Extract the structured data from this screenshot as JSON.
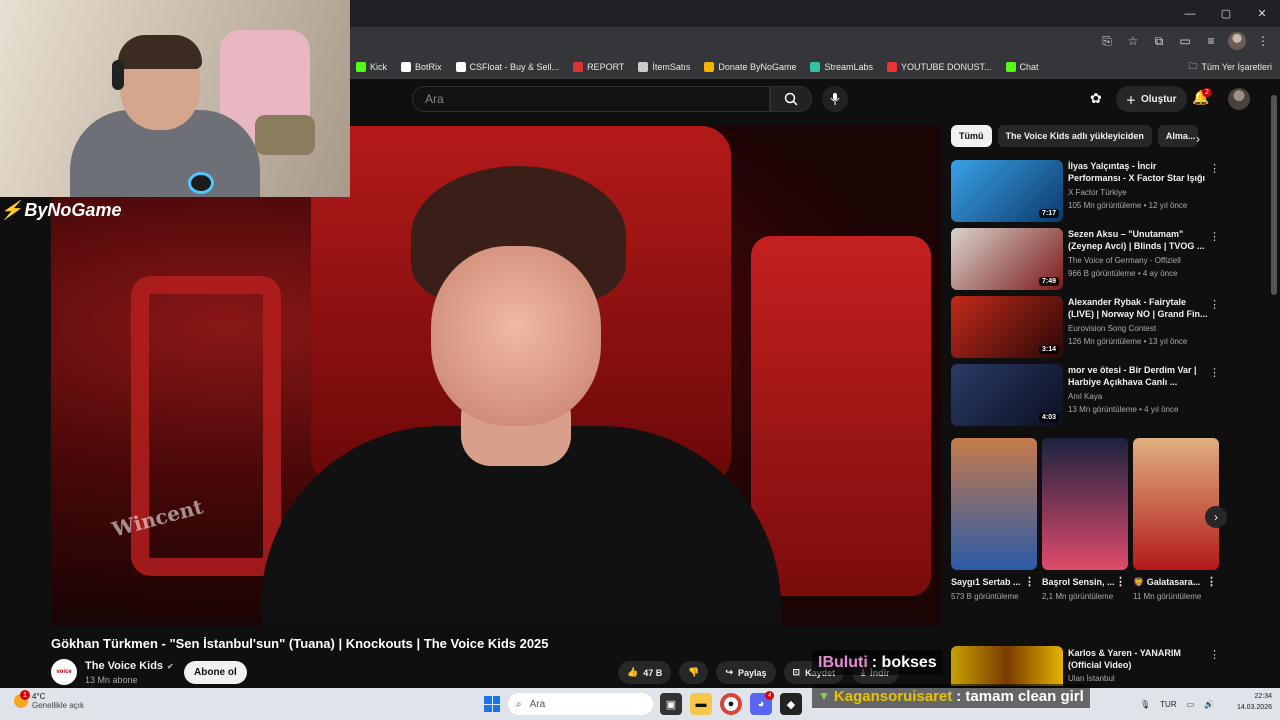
{
  "browser": {
    "controls": [
      "—",
      "▢",
      "✕"
    ],
    "bookmarks": [
      {
        "label": "Kick",
        "color": "#53fc18"
      },
      {
        "label": "BotRix",
        "color": "#ffffff"
      },
      {
        "label": "CSFloat - Buy & Sell...",
        "color": "#ffffff"
      },
      {
        "label": "REPORT",
        "color": "#d33"
      },
      {
        "label": "İtemSatıs",
        "color": "#ccc"
      },
      {
        "label": "Donate ByNoGame",
        "color": "#f7b500"
      },
      {
        "label": "StreamLabs",
        "color": "#31c3a2"
      },
      {
        "label": "YOUTUBE DONUST...",
        "color": "#e33"
      },
      {
        "label": "Chat",
        "color": "#53fc18"
      }
    ],
    "all_bookmarks": "Tüm Yer İşaretleri"
  },
  "youtube": {
    "search_placeholder": "Ara",
    "create_label": "Oluştur",
    "notification_count": "2"
  },
  "video": {
    "title": "Gökhan Türkmen - \"Sen İstanbul'sun\" (Tuana) | Knockouts | The Voice Kids 2025",
    "watermark": "Wincent",
    "channel": "The Voice Kids",
    "subscribers": "13 Mn abone",
    "subscribe_label": "Abone ol",
    "likes": "47 B",
    "share_label": "Paylaş",
    "save_label": "Kaydet",
    "download_label": "İndir"
  },
  "chips": [
    "Tümü",
    "The Voice Kids adlı yükleyiciden",
    "Alma..."
  ],
  "recommendations": [
    {
      "title": "İlyas Yalçıntaş - İncir Performansı - X Factor Star Işığı",
      "channel": "X Factor Türkiye",
      "meta": "105 Mn görüntüleme • 12 yıl önce",
      "duration": "7:17",
      "color1": "#3aa1e6",
      "color2": "#0b3a6b"
    },
    {
      "title": "Sezen Aksu – \"Unutamam\" (Zeynep Avci) | Blinds | TVOG ...",
      "channel": "The Voice of Germany - Offiziell",
      "meta": "966 B görüntüleme • 4 ay önce",
      "duration": "7:49",
      "color1": "#d9d4cc",
      "color2": "#7b1a1a"
    },
    {
      "title": "Alexander Rybak - Fairytale (LIVE) | Norway NO | Grand Fin...",
      "channel": "Eurovision Song Contest",
      "meta": "126 Mn görüntüleme • 13 yıl önce",
      "duration": "3:14",
      "color1": "#c22a1a",
      "color2": "#2a0808"
    },
    {
      "title": "mor ve ötesi - Bir Derdim Var | Harbiye Açıkhava Canlı ...",
      "channel": "Anıl Kaya",
      "meta": "13 Mn görüntüleme • 4 yıl önce",
      "duration": "4:03",
      "color1": "#2b3b66",
      "color2": "#0a0f22"
    }
  ],
  "shorts": [
    {
      "title": "Saygı1 Sertab ...",
      "views": "573 B görüntüleme",
      "c1": "#c77b4a",
      "c2": "#2a5aa8"
    },
    {
      "title": "Başrol Sensin, ...",
      "views": "2,1 Mn görüntüleme",
      "c1": "#1b2340",
      "c2": "#e04a6a"
    },
    {
      "title": "🦁 Galatasara...",
      "views": "11 Mn görüntüleme",
      "c1": "#e0b080",
      "c2": "#b31a1a"
    }
  ],
  "rec5": {
    "title": "Karlos & Yaren - YANARIM (Official Video)",
    "channel": "Ulan İstanbul"
  },
  "stream": {
    "logo": "ByNoGame",
    "chat": [
      {
        "user": "IBuluti",
        "message": ": bokses"
      },
      {
        "user": "Kagansoruisaret",
        "message": ": tamam clean girl"
      }
    ]
  },
  "taskbar": {
    "temp": "4°C",
    "weather": "Genellikle açık",
    "weather_badge": "1",
    "search": "Ara",
    "lang": "TUR",
    "time": "22:34",
    "date": "14.03.2026",
    "discord_badge": "4"
  }
}
